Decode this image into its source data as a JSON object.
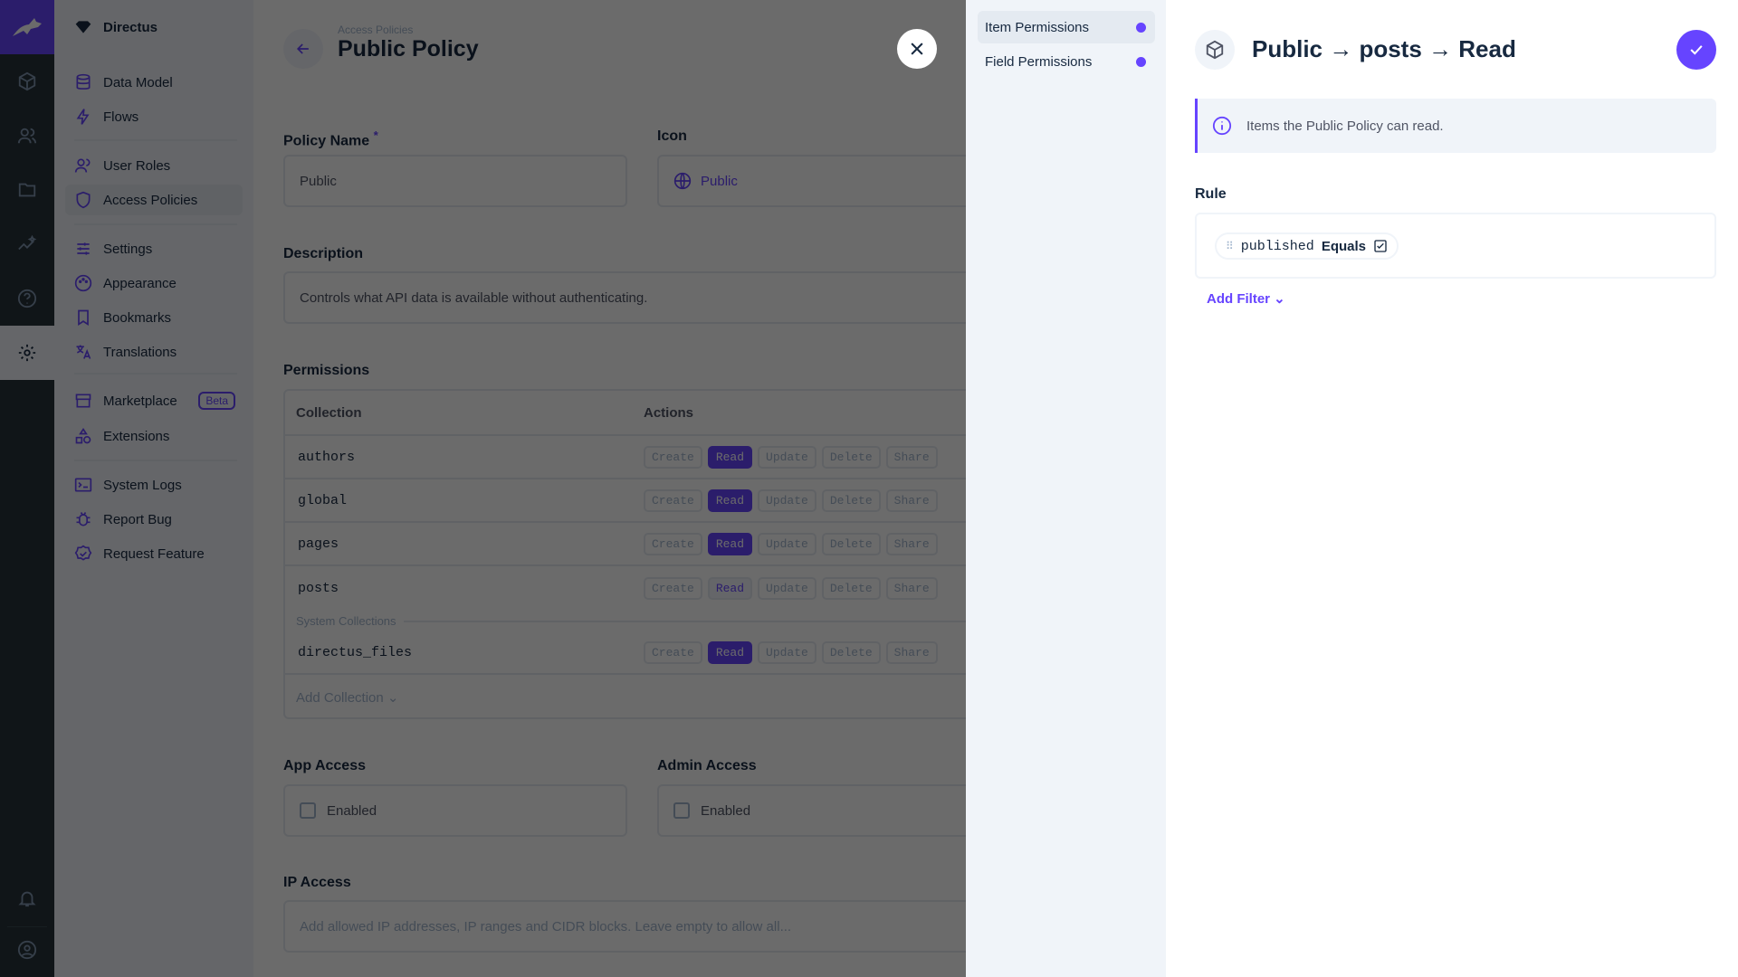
{
  "rail": {
    "items": [
      "content",
      "users",
      "files",
      "insights",
      "help",
      "settings"
    ],
    "bottom": [
      "notifications",
      "account"
    ]
  },
  "sidebar": {
    "project": "Directus",
    "items": [
      {
        "label": "Data Model"
      },
      {
        "label": "Flows"
      },
      {
        "label": "User Roles"
      },
      {
        "label": "Access Policies"
      },
      {
        "label": "Settings"
      },
      {
        "label": "Appearance"
      },
      {
        "label": "Bookmarks"
      },
      {
        "label": "Translations"
      },
      {
        "label": "Marketplace",
        "badge": "Beta"
      },
      {
        "label": "Extensions"
      },
      {
        "label": "System Logs"
      },
      {
        "label": "Report Bug"
      },
      {
        "label": "Request Feature"
      }
    ]
  },
  "header": {
    "breadcrumb": "Access Policies",
    "title": "Public Policy"
  },
  "form": {
    "policy_name": {
      "label": "Policy Name",
      "required": "*",
      "value": "Public"
    },
    "icon": {
      "label": "Icon",
      "value": "Public"
    },
    "description": {
      "label": "Description",
      "value": "Controls what API data is available without authenticating."
    },
    "permissions": {
      "label": "Permissions",
      "col_collection": "Collection",
      "col_actions": "Actions",
      "actions": [
        "Create",
        "Read",
        "Update",
        "Delete",
        "Share"
      ],
      "rows": [
        {
          "name": "authors",
          "read": "full"
        },
        {
          "name": "global",
          "read": "full"
        },
        {
          "name": "pages",
          "read": "full"
        },
        {
          "name": "posts",
          "read": "partial"
        }
      ],
      "system_label": "System Collections",
      "system_rows": [
        {
          "name": "directus_files",
          "read": "full"
        }
      ],
      "add_collection": "Add Collection"
    },
    "app_access": {
      "label": "App Access",
      "checkbox": "Enabled",
      "checked": false
    },
    "admin_access": {
      "label": "Admin Access",
      "checkbox": "Enabled",
      "checked": false
    },
    "ip_access": {
      "label": "IP Access",
      "placeholder": "Add allowed IP addresses, IP ranges and CIDR blocks. Leave empty to allow all..."
    }
  },
  "drawer": {
    "nav": [
      {
        "label": "Item Permissions"
      },
      {
        "label": "Field Permissions"
      }
    ],
    "title": "Public → posts → Read",
    "notice": "Items the Public Policy can read.",
    "rule_label": "Rule",
    "filter": {
      "field": "published",
      "operator": "Equals",
      "value_checked": true
    },
    "add_filter": "Add Filter"
  },
  "colors": {
    "accent": "#6644ff",
    "rail": "#263238",
    "sidebar": "#f0f4f9"
  }
}
